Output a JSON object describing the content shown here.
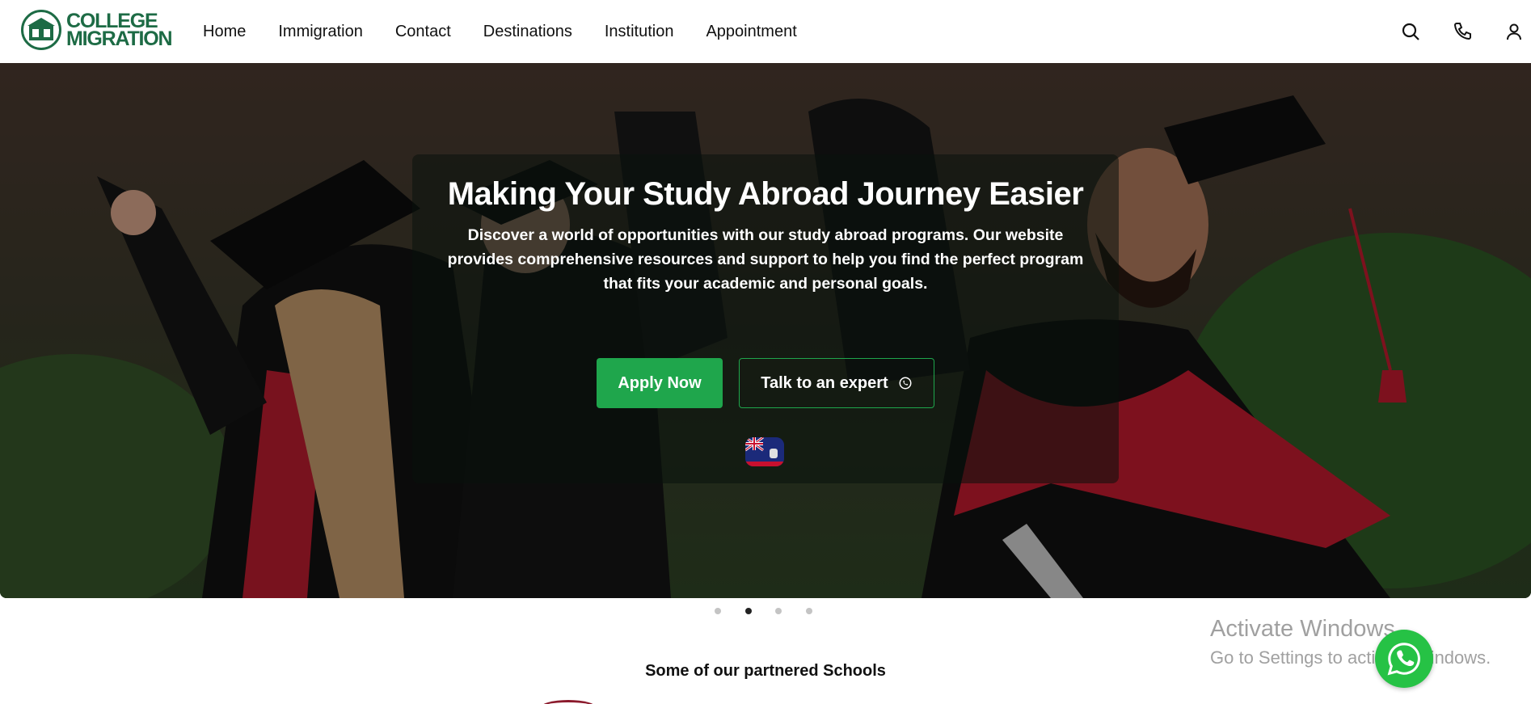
{
  "brand": {
    "name_line1": "COLLEGE",
    "name_line2": "MIGRATION",
    "color": "#1d6b45"
  },
  "nav": {
    "items": [
      {
        "label": "Home"
      },
      {
        "label": "Immigration"
      },
      {
        "label": "Contact"
      },
      {
        "label": "Destinations"
      },
      {
        "label": "Institution"
      },
      {
        "label": "Appointment"
      }
    ]
  },
  "header_icons": [
    "search-icon",
    "phone-icon",
    "user-icon"
  ],
  "hero": {
    "title": "Making Your Study Abroad Journey Easier",
    "description": "Discover a world of opportunities with our study abroad programs. Our website provides comprehensive resources and support to help you find the perfect program that fits your academic and personal goals.",
    "apply_label": "Apply Now",
    "expert_label": "Talk to an expert",
    "accent_color": "#1fa64c"
  },
  "carousel": {
    "slide_count": 4,
    "active_index": 1
  },
  "partners": {
    "title": "Some of our partnered Schools"
  },
  "watermark": {
    "line1": "Activate Windows",
    "line2": "Go to Settings to activate Windows."
  }
}
